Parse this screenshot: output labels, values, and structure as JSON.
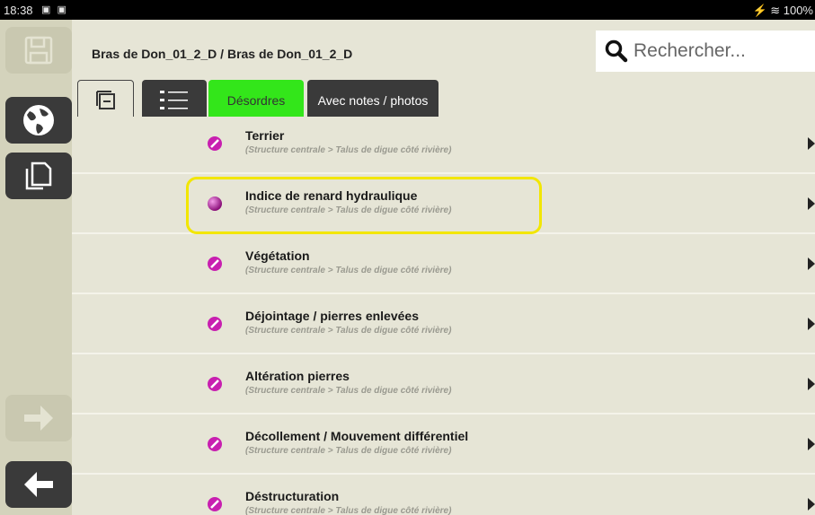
{
  "status_bar": {
    "time": "18:38",
    "notif_icons": "▣ ▣",
    "system": "⚡ ≋ 100%"
  },
  "header": {
    "breadcrumb": "Bras de Don_01_2_D / Bras de Don_01_2_D",
    "search_placeholder": "Rechercher..."
  },
  "toolbar": {
    "desordres": "Désordres",
    "notes": "Avec notes / photos"
  },
  "rows": [
    {
      "title": "Terrier",
      "subtitle": "(Structure centrale > Talus de digue côté rivière)"
    },
    {
      "title": "Indice de renard hydraulique",
      "subtitle": "(Structure centrale > Talus de digue côté rivière)"
    },
    {
      "title": "Végétation",
      "subtitle": "(Structure centrale > Talus de digue côté rivière)"
    },
    {
      "title": "Déjointage / pierres enlevées",
      "subtitle": "(Structure centrale > Talus de digue côté rivière)"
    },
    {
      "title": "Altération pierres",
      "subtitle": "(Structure centrale > Talus de digue côté rivière)"
    },
    {
      "title": "Décollement / Mouvement différentiel",
      "subtitle": "(Structure centrale > Talus de digue côté rivière)"
    },
    {
      "title": "Déstructuration",
      "subtitle": "(Structure centrale > Talus de digue côté rivière)"
    }
  ],
  "colors": {
    "accent_green": "#33e61a",
    "highlight": "#f2e600",
    "bullet": "#c81fb0"
  },
  "icons": [
    "save-icon",
    "globe-icon",
    "copy-icon",
    "arrow-right-icon",
    "arrow-left-icon",
    "square-icon",
    "list-icon",
    "search-icon",
    "chevron-right-icon",
    "disorder-icon"
  ]
}
